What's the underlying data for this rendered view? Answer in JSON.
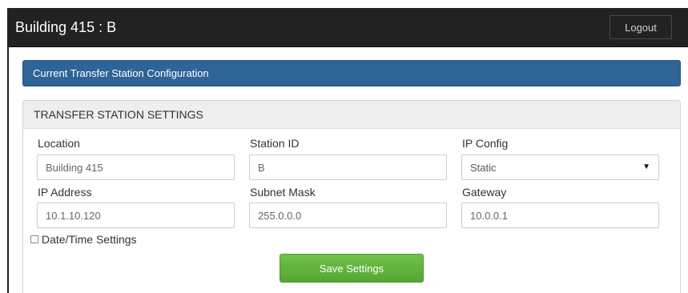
{
  "navbar": {
    "brand": "Building 415 : B",
    "logout_label": "Logout"
  },
  "config_header": {
    "title": "Current Transfer Station Configuration"
  },
  "settings_panel": {
    "heading": "TRANSFER STATION SETTINGS",
    "fields": {
      "location": {
        "label": "Location",
        "value": "Building 415"
      },
      "station_id": {
        "label": "Station ID",
        "value": "B"
      },
      "ip_config": {
        "label": "IP Config",
        "value": "Static"
      },
      "ip_address": {
        "label": "IP Address",
        "value": "10.1.10.120"
      },
      "subnet_mask": {
        "label": "Subnet Mask",
        "value": "255.0.0.0"
      },
      "gateway": {
        "label": "Gateway",
        "value": "10.0.0.1"
      }
    },
    "datetime_checkbox": {
      "label": "Date/Time Settings",
      "checked": false
    },
    "save_label": "Save Settings"
  },
  "colors": {
    "navbar_bg": "#222222",
    "header_blue": "#2e6496",
    "save_green": "#5cb85c"
  },
  "icons": {
    "select_arrow": "caret-down-icon",
    "checkbox": "checkbox-icon"
  }
}
